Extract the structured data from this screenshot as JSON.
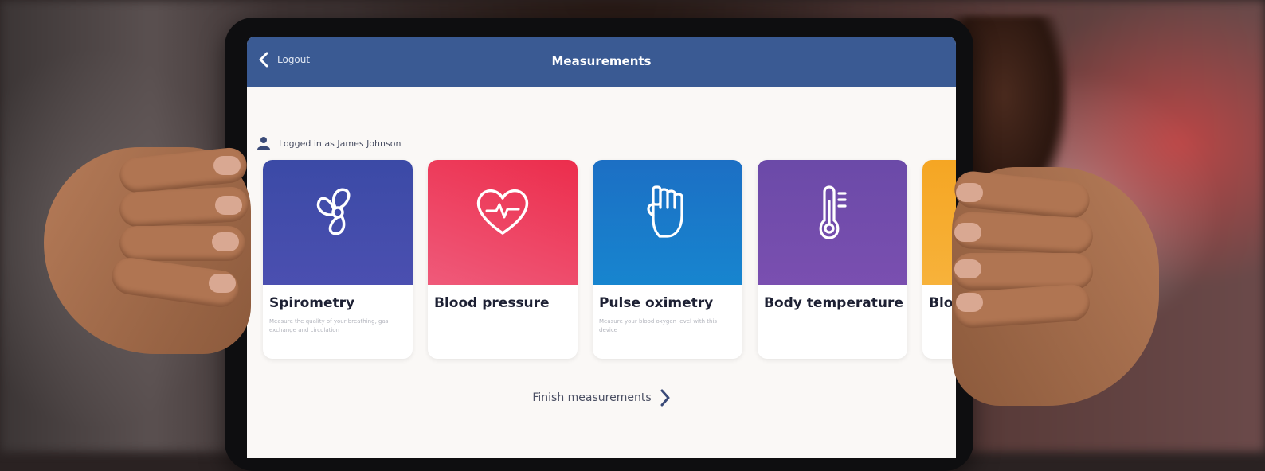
{
  "header": {
    "back_label": "Logout",
    "title": "Measurements"
  },
  "user": {
    "logged_in_text": "Logged in as James Johnson"
  },
  "cards": [
    {
      "name": "Spirometry",
      "description": "Measure the quality of your breathing, gas exchange and circulation",
      "icon": "fan-icon",
      "color_top": "#3b4aa6",
      "color_bottom": "#4b4fb0"
    },
    {
      "name": "Blood pressure",
      "description": "",
      "icon": "heart-pulse-icon",
      "color_top": "#ec2d4c",
      "color_bottom": "#ef5a7a"
    },
    {
      "name": "Pulse oximetry",
      "description": "Measure your blood oxygen level with this device",
      "icon": "hand-icon",
      "color_top": "#1c6fc4",
      "color_bottom": "#1785cf"
    },
    {
      "name": "Body temperature",
      "description": "",
      "icon": "thermometer-icon",
      "color_top": "#6b4aa8",
      "color_bottom": "#7a4fb0"
    },
    {
      "name": "Blo",
      "description": "",
      "icon": "",
      "color_top": "#f5a623",
      "color_bottom": "#f7b23b"
    }
  ],
  "footer": {
    "finish_label": "Finish measurements"
  },
  "colors": {
    "header_bg": "#3a5a93",
    "screen_bg": "#faf8f6",
    "text_dark": "#1d2033"
  }
}
